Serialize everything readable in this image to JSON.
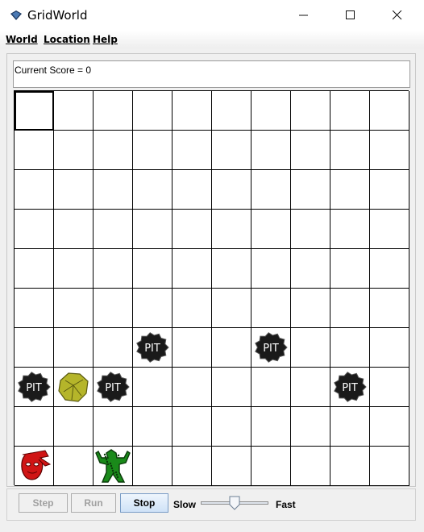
{
  "window": {
    "title": "GridWorld"
  },
  "menu": {
    "world": "World",
    "location": "Location",
    "help": "Help"
  },
  "score": {
    "text": "Current Score = 0"
  },
  "grid": {
    "rows": 10,
    "cols": 10,
    "selected": {
      "row": 0,
      "col": 0
    },
    "occupants": [
      {
        "type": "pit",
        "row": 6,
        "col": 3,
        "label": "PIT"
      },
      {
        "type": "pit",
        "row": 6,
        "col": 6,
        "label": "PIT"
      },
      {
        "type": "pit",
        "row": 7,
        "col": 0,
        "label": "PIT"
      },
      {
        "type": "gold",
        "row": 7,
        "col": 1
      },
      {
        "type": "pit",
        "row": 7,
        "col": 2,
        "label": "PIT"
      },
      {
        "type": "pit",
        "row": 7,
        "col": 8,
        "label": "PIT"
      },
      {
        "type": "agent",
        "row": 9,
        "col": 0
      },
      {
        "type": "wumpus",
        "row": 9,
        "col": 2
      }
    ]
  },
  "controls": {
    "step": "Step",
    "run": "Run",
    "stop": "Stop",
    "slow": "Slow",
    "fast": "Fast",
    "speed_fraction": 0.5
  },
  "colors": {
    "pit": "#1a1a1a",
    "gold": "#b5b52a",
    "agent": "#d01515",
    "wumpus": "#1a8a1a"
  }
}
